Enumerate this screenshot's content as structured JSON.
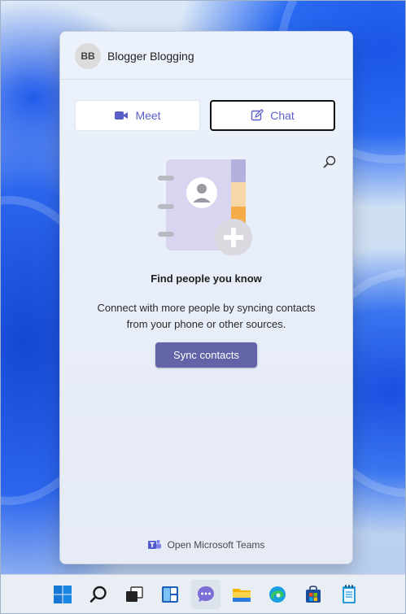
{
  "user": {
    "initials": "BB",
    "name": "Blogger Blogging"
  },
  "buttons": {
    "meet_label": "Meet",
    "chat_label": "Chat",
    "sync_label": "Sync contacts"
  },
  "empty_state": {
    "title": "Find people you know",
    "line1": "Connect with more people by syncing contacts",
    "line2": "from your phone or other sources."
  },
  "footer": {
    "link_label": "Open Microsoft Teams"
  },
  "colors": {
    "accent": "#5b5fc7",
    "button_primary": "#6264a7"
  },
  "taskbar": {
    "icons": [
      "start-icon",
      "search-icon",
      "task-view-icon",
      "widgets-icon",
      "chat-icon",
      "file-explorer-icon",
      "edge-icon",
      "store-icon",
      "notepad-icon"
    ]
  }
}
